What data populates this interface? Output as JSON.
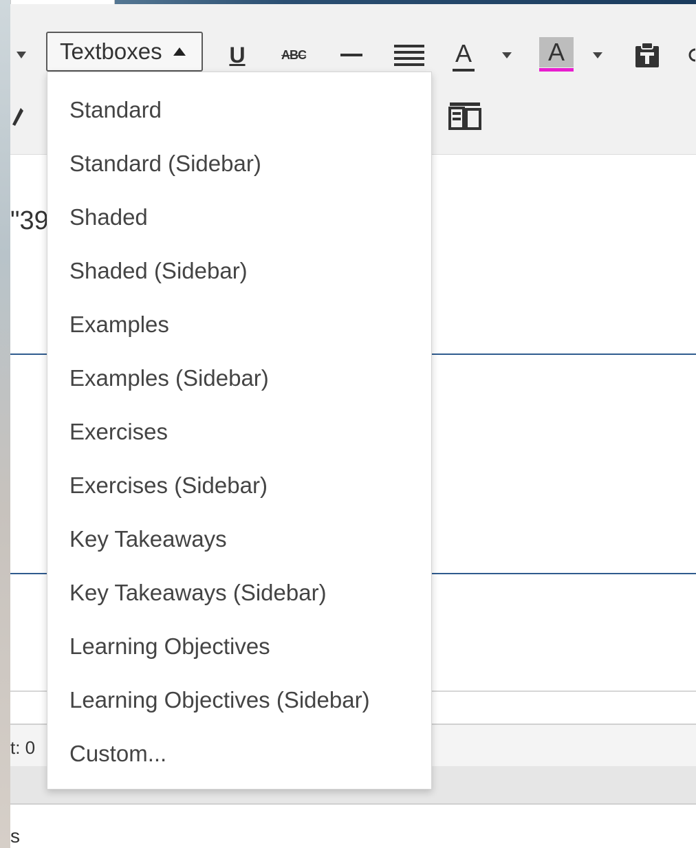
{
  "toolbar": {
    "textboxes_label": "Textboxes",
    "underline_label": "U",
    "strikethrough_label": "ABC",
    "font_color_label": "A",
    "bg_color_label": "A",
    "bg_color_accent": "#e81ecf"
  },
  "editor": {
    "fragment_text": "\"39",
    "status_text": "t: 0",
    "bottom_fragment": "s"
  },
  "dropdown": {
    "items": [
      "Standard",
      "Standard (Sidebar)",
      "Shaded",
      "Shaded (Sidebar)",
      "Examples",
      "Examples (Sidebar)",
      "Exercises",
      "Exercises (Sidebar)",
      "Key Takeaways",
      "Key Takeaways (Sidebar)",
      "Learning Objectives",
      "Learning Objectives (Sidebar)",
      "Custom..."
    ]
  }
}
